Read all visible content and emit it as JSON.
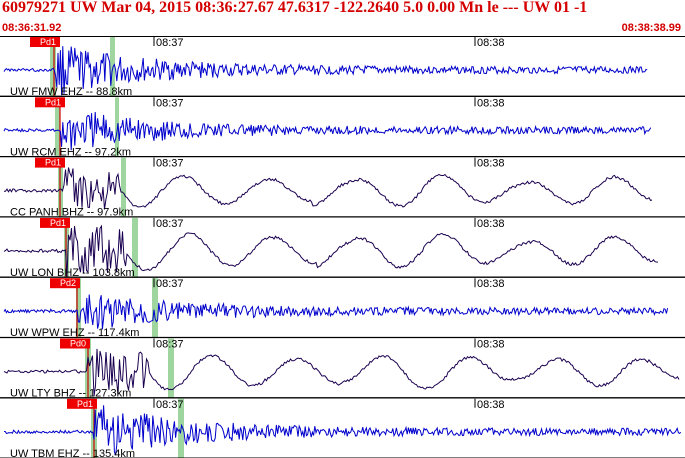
{
  "header": {
    "title": "60979271 UW Mar 04, 2015 08:36:27.67   47.6317  -122.2640  5.0 0.00 Mn le --- UW 01  -1",
    "start_time": "08:36:31.92",
    "end_time": "08:38:38.99"
  },
  "time_labels": [
    "08:37",
    "08:38"
  ],
  "colors": {
    "blue_trace": "#0000cc",
    "dark_trace": "#1a0050",
    "pick_box": "#ee0000",
    "pick_text": "#ffffff",
    "green_band": "#9fd69f",
    "title_red": "#d40000"
  },
  "traces": [
    {
      "label": "UW FMW EHZ -- 88.8km",
      "pick": "Pd1",
      "color": "blue"
    },
    {
      "label": "UW RCM EHZ -- 97.2km",
      "pick": "Pd1",
      "color": "blue"
    },
    {
      "label": "CC PANH BHZ -- 97.9km",
      "pick": "Pd1",
      "color": "dark"
    },
    {
      "label": "UW LON BHZ -- 103.8km",
      "pick": "Pd1",
      "color": "dark"
    },
    {
      "label": "UW WPW EHZ -- 117.4km",
      "pick": "Pd2",
      "color": "blue"
    },
    {
      "label": "UW LTY BHZ -- 127.3km",
      "pick": "Pd0",
      "color": "dark"
    },
    {
      "label": "UW TBM EHZ -- 135.4km",
      "pick": "Pd1",
      "color": "blue"
    }
  ]
}
